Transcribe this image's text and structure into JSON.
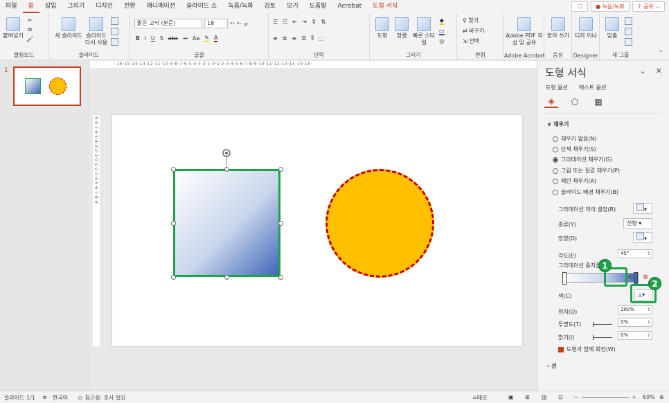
{
  "tabs": [
    "파일",
    "홈",
    "삽입",
    "그리기",
    "디자인",
    "전환",
    "애니메이션",
    "슬라이드 쇼",
    "녹음/녹화",
    "검토",
    "보기",
    "도움말",
    "Acrobat",
    "도형 서식"
  ],
  "tab_right": {
    "comment_label": "",
    "record_label": "● 녹음/녹화",
    "share_label": "공유"
  },
  "ribbon": {
    "clipboard": {
      "paste": "붙여넣기",
      "group": "클립보드"
    },
    "slides": {
      "new_slide": "새 슬라이드",
      "reuse": "슬라이드 다시 사용",
      "group": "슬라이드"
    },
    "font": {
      "font_name": "맑은 고딕 (본문)",
      "font_size": "18",
      "group": "글꼴"
    },
    "paragraph": {
      "group": "단락"
    },
    "drawing": {
      "shapes": "도형",
      "arrange": "정렬",
      "quick_styles": "빠른 스타일",
      "group": "그리기"
    },
    "editing": {
      "find": "찾기",
      "replace": "바꾸기",
      "select": "선택",
      "group": "편집"
    },
    "acrobat": {
      "create": "Adobe PDF 작성 및 공유",
      "group": "Adobe Acrobat"
    },
    "voice": {
      "dictate": "받아 쓰기",
      "group": "음성"
    },
    "designer": {
      "designer": "디자 이너",
      "group": "Designer"
    },
    "newgroup": {
      "fit": "맞춤",
      "group": "새 그룹"
    }
  },
  "thumbnail": {
    "number": "1"
  },
  "hruler": "·16·15·14·13·12·11·10·9·8·7·6·5·4·3·2·1·0·1·2·3·4·5·6·7·8·9·10·11·12·13·14·15·16·",
  "vruler": "·9·8·7·6·5·4·3·2·1·0·1·2·3·4·5·6·7·8·9·",
  "pane": {
    "title": "도형 서식",
    "subtab_shape": "도형 옵션",
    "subtab_text": "텍스트 옵션",
    "fill_section": "∨ 채우기",
    "fill_options": [
      "채우기 없음(N)",
      "단색 채우기(S)",
      "그라데이션 채우기(G)",
      "그림 또는 질감 채우기(P)",
      "패턴 채우기(A)",
      "슬라이드 배경 채우기(B)"
    ],
    "fill_selected_index": 2,
    "preset_label": "그라데이션 미리 설정(R)",
    "type_label": "종류(Y)",
    "type_value": "선형",
    "direction_label": "방향(D)",
    "angle_label": "각도(E)",
    "angle_value": "45°",
    "stops_label": "그라데이션 중지점",
    "color_label": "색(C)",
    "position_label": "위치(O)",
    "position_value": "100%",
    "transparency_label": "투명도(T)",
    "transparency_value": "0%",
    "brightness_label": "밝기(I)",
    "brightness_value": "0%",
    "rotate_label": "도형과 함께 회전(W)",
    "line_section": "› 선",
    "badge1": "1",
    "badge2": "2"
  },
  "status": {
    "slide": "슬라이드 1/1",
    "language": "한국어",
    "accessibility": "접근성: 조사 필요",
    "notes": "≐메모",
    "zoom": "69%"
  },
  "colors": {
    "accent": "#c43e1c",
    "callout": "#1fa34a",
    "circle_fill": "#ffc000",
    "circle_border": "#c00000",
    "gradient_end": "#3f67b8"
  }
}
